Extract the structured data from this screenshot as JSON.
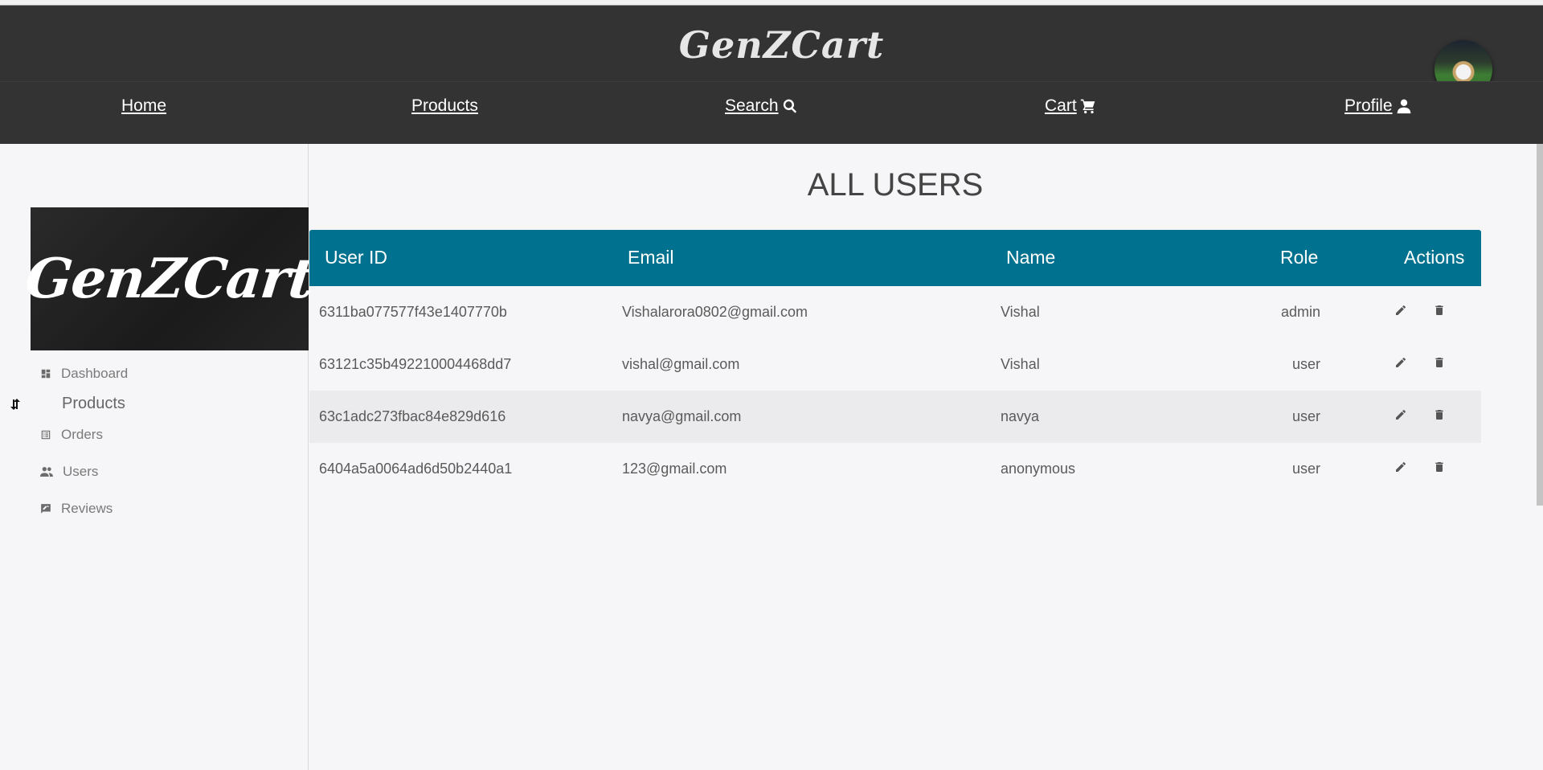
{
  "brand": "GenZCart",
  "nav": {
    "home": "Home",
    "products": "Products",
    "search": "Search ",
    "cart": "Cart ",
    "profile": "Profile "
  },
  "sidebar": {
    "logo_text": "GenZCart",
    "dashboard": "Dashboard",
    "products": "Products",
    "orders": "Orders",
    "users": "Users",
    "reviews": "Reviews"
  },
  "page_title": "ALL USERS",
  "table": {
    "headers": {
      "user_id": "User ID",
      "email": "Email",
      "name": "Name",
      "role": "Role",
      "actions": "Actions"
    },
    "rows": [
      {
        "user_id": "6311ba077577f43e1407770b",
        "email": "Vishalarora0802@gmail.com",
        "name": "Vishal",
        "role": "admin"
      },
      {
        "user_id": "63121c35b492210004468dd7",
        "email": "vishal@gmail.com",
        "name": "Vishal",
        "role": "user"
      },
      {
        "user_id": "63c1adc273fbac84e829d616",
        "email": "navya@gmail.com",
        "name": "navya",
        "role": "user"
      },
      {
        "user_id": "6404a5a0064ad6d50b2440a1",
        "email": "123@gmail.com",
        "name": "anonymous",
        "role": "user"
      }
    ]
  },
  "colors": {
    "header_bg": "#333333",
    "table_header_bg": "#00728f",
    "page_bg": "#f6f6f8"
  }
}
